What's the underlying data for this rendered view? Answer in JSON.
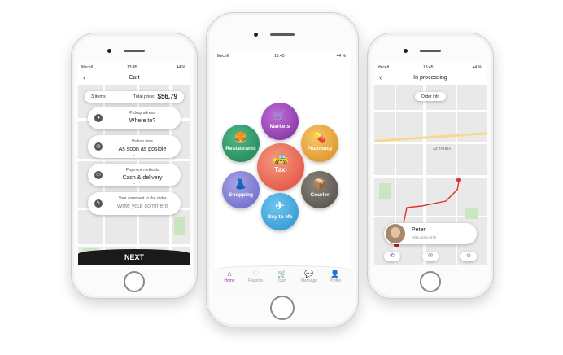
{
  "colors": {
    "accent": "#8b3db0",
    "next_bg": "#1a1a1a",
    "route": "#e0302e"
  },
  "left_phone": {
    "status": {
      "carrier": "lifecell",
      "time": "13:45",
      "battery": "44 %"
    },
    "title": "Cart",
    "back_icon": "arrow-left-icon",
    "summary": {
      "items": "3 items",
      "total_label": "Total price:",
      "total_value": "$56,79"
    },
    "fields": [
      {
        "label": "Pickup adress",
        "value": "Where to?",
        "icon": "location-pin-icon"
      },
      {
        "label": "Pickup time",
        "value": "As soon as posible",
        "icon": "clock-icon"
      },
      {
        "label": "Payment methods",
        "value": "Cash & delivery",
        "icon": "card-icon"
      },
      {
        "label": "Your comment to the order",
        "value": "Write your comment",
        "icon": "pencil-icon"
      }
    ],
    "next": "NEXT"
  },
  "center_phone": {
    "status": {
      "carrier": "lifecell",
      "time": "13:45",
      "battery": "44 %"
    },
    "categories": {
      "markets": "Markets",
      "restaurants": "Restaurants",
      "pharmacy": "Pharmacy",
      "taxi": "Taxi",
      "shopping": "Shopping",
      "courier": "Courier",
      "buy": "Buy to Me"
    },
    "tabs": [
      {
        "label": "Home",
        "icon": "home-icon"
      },
      {
        "label": "Favorits",
        "icon": "heart-icon"
      },
      {
        "label": "Cart",
        "icon": "cart-icon"
      },
      {
        "label": "Message",
        "icon": "chat-icon"
      },
      {
        "label": "Profile",
        "icon": "user-icon"
      }
    ]
  },
  "right_phone": {
    "status": {
      "carrier": "lifecell",
      "time": "13:45",
      "battery": "44 %"
    },
    "title": "In processing",
    "order_info": "Order info",
    "map_label": "AZ ZAHRA",
    "driver": {
      "name": "Peter",
      "car": "Mitsubishi (470"
    },
    "actions": [
      "phone-icon",
      "message-icon",
      "cancel-icon"
    ]
  }
}
